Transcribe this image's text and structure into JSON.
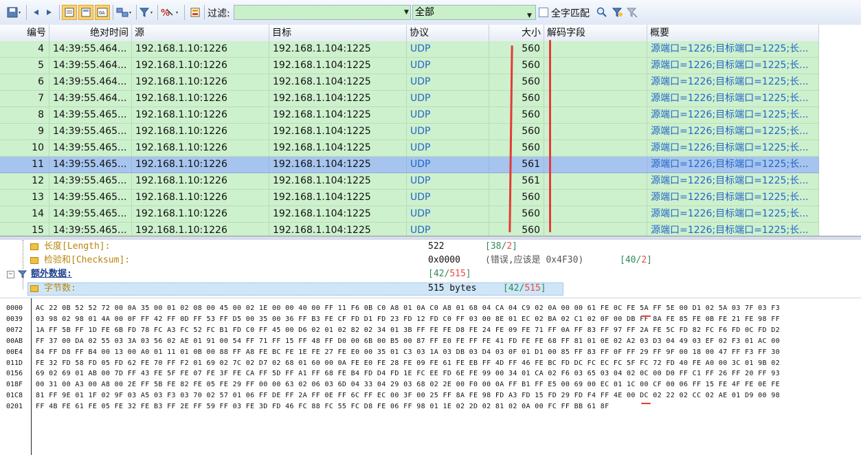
{
  "toolbar": {
    "filter_label": "过滤:",
    "filter_value": "",
    "scope_value": "全部",
    "full_match_label": "全字匹配",
    "icons": [
      "save-icon",
      "back-icon",
      "forward-icon",
      "view-list-icon",
      "view-detail-icon",
      "view-hex-icon",
      "network-icon",
      "filter-icon",
      "decode-icon",
      "clear-icon",
      "search-icon",
      "filter-apply-icon",
      "filter-clear-icon"
    ]
  },
  "grid": {
    "columns": [
      "编号",
      "绝对时间",
      "源",
      "目标",
      "协议",
      "大小",
      "解码字段",
      "概要"
    ],
    "rows": [
      {
        "id": "4",
        "time": "14:39:55.464...",
        "src": "192.168.1.10:1226",
        "dst": "192.168.1.104:1225",
        "proto": "UDP",
        "size": "560",
        "decode": "",
        "summary": "源端口=1226;目标端口=1225;长..."
      },
      {
        "id": "5",
        "time": "14:39:55.464...",
        "src": "192.168.1.10:1226",
        "dst": "192.168.1.104:1225",
        "proto": "UDP",
        "size": "560",
        "decode": "",
        "summary": "源端口=1226;目标端口=1225;长..."
      },
      {
        "id": "6",
        "time": "14:39:55.464...",
        "src": "192.168.1.10:1226",
        "dst": "192.168.1.104:1225",
        "proto": "UDP",
        "size": "560",
        "decode": "",
        "summary": "源端口=1226;目标端口=1225;长..."
      },
      {
        "id": "7",
        "time": "14:39:55.464...",
        "src": "192.168.1.10:1226",
        "dst": "192.168.1.104:1225",
        "proto": "UDP",
        "size": "560",
        "decode": "",
        "summary": "源端口=1226;目标端口=1225;长..."
      },
      {
        "id": "8",
        "time": "14:39:55.465...",
        "src": "192.168.1.10:1226",
        "dst": "192.168.1.104:1225",
        "proto": "UDP",
        "size": "560",
        "decode": "",
        "summary": "源端口=1226;目标端口=1225;长..."
      },
      {
        "id": "9",
        "time": "14:39:55.465...",
        "src": "192.168.1.10:1226",
        "dst": "192.168.1.104:1225",
        "proto": "UDP",
        "size": "560",
        "decode": "",
        "summary": "源端口=1226;目标端口=1225;长..."
      },
      {
        "id": "10",
        "time": "14:39:55.465...",
        "src": "192.168.1.10:1226",
        "dst": "192.168.1.104:1225",
        "proto": "UDP",
        "size": "560",
        "decode": "",
        "summary": "源端口=1226;目标端口=1225;长..."
      },
      {
        "id": "11",
        "time": "14:39:55.465...",
        "src": "192.168.1.10:1226",
        "dst": "192.168.1.104:1225",
        "proto": "UDP",
        "size": "561",
        "decode": "",
        "summary": "源端口=1226;目标端口=1225;长..."
      },
      {
        "id": "12",
        "time": "14:39:55.465...",
        "src": "192.168.1.10:1226",
        "dst": "192.168.1.104:1225",
        "proto": "UDP",
        "size": "561",
        "decode": "",
        "summary": "源端口=1226;目标端口=1225;长..."
      },
      {
        "id": "13",
        "time": "14:39:55.465...",
        "src": "192.168.1.10:1226",
        "dst": "192.168.1.104:1225",
        "proto": "UDP",
        "size": "560",
        "decode": "",
        "summary": "源端口=1226;目标端口=1225;长..."
      },
      {
        "id": "14",
        "time": "14:39:55.465...",
        "src": "192.168.1.10:1226",
        "dst": "192.168.1.104:1225",
        "proto": "UDP",
        "size": "560",
        "decode": "",
        "summary": "源端口=1226;目标端口=1225;长..."
      },
      {
        "id": "15",
        "time": "14:39:55.465...",
        "src": "192.168.1.10:1226",
        "dst": "192.168.1.104:1225",
        "proto": "UDP",
        "size": "560",
        "decode": "",
        "summary": "源端口=1226;目标端口=1225;长..."
      }
    ],
    "selected_id": "11"
  },
  "tree": {
    "length": {
      "label": "长度[Length]:",
      "value": "522",
      "pos_open": "[",
      "pos_off": "38",
      "pos_sep": "/",
      "pos_len": "2",
      "pos_close": "]"
    },
    "checksum": {
      "label": "检验和[Checksum]:",
      "value": "0x0000",
      "note": "(错误,应该是 0x4F30)",
      "pos_open": "[",
      "pos_off": "40",
      "pos_sep": "/",
      "pos_len": "2",
      "pos_close": "]"
    },
    "extra": {
      "label": "额外数据:",
      "pos_open": "[",
      "pos_off": "42",
      "pos_sep": "/",
      "pos_len": "515",
      "pos_close": "]"
    },
    "bytes": {
      "label": "字节数:",
      "value": "515 bytes",
      "pos_open": "[",
      "pos_off": "42",
      "pos_sep": "/",
      "pos_len": "515",
      "pos_close": "]"
    }
  },
  "hex": {
    "lines": [
      {
        "offset": "0000",
        "bytes": "AC 22 0B 52 52 72 00 0A 35 00 01 02 08 00 45 00 02 1E 00 00 40 00 FF 11 F6 0B C0 A8 01 0A C0 A8 01 68 04 CA 04 C9 02 0A 00 00 61 FE 0C FE 5A FF 5E 00 D1 02 5A 03 7F 03 F3"
      },
      {
        "offset": "0039",
        "bytes": "03 98 02 98 01 4A 00 0F FF 42 FF 0D FF 53 FF D5 00 35 00 36 FF B3 FE CF FD D1 FD 23 FD 12 FD C0 FF 03 00 8E 01 EC 02 BA 02 C1 02 0F 00 DB FF 8A FE 85 FE 0B FE 21 FE 98 FF"
      },
      {
        "offset": "0072",
        "bytes": "1A FF 5B FF 1D FE 6B FD 78 FC A3 FC 52 FC B1 FD C0 FF 45 00 D6 02 01 02 82 02 34 01 3B FF FE FE D8 FE 24 FE 09 FE 71 FF 0A FF 83 FF 97 FF 2A FE 5C FD 82 FC F6 FD 0C FD D2"
      },
      {
        "offset": "00AB",
        "bytes": "FF 37 00 DA 02 55 03 3A 03 56 02 AE 01 91 00 54 FF 71 FF 15 FF 48 FF D0 00 6B 00 B5 00 87 FF E0 FE FF FE 41 FD FE FE 68 FF 81 01 0E 02 A2 03 D3 04 49 03 EF 02 F3 01 AC 00"
      },
      {
        "offset": "00E4",
        "bytes": "84 FF D8 FF B4 00 13 00 A0 01 11 01 0B 00 88 FF A8 FE BC FE 1E FE 27 FE E0 00 35 01 C3 03 1A 03 DB 03 D4 03 0F 01 D1 00 85 FF 83 FF 0F FF 29 FF 9F 00 18 00 47 FF F3 FF 30"
      },
      {
        "offset": "011D",
        "bytes": "FE 32 FD 58 FD 05 FD 62 FE 70 FF F2 01 69 02 7C 02 D7 02 68 01 60 00 0A FE E0 FE 28 FE 09 FE 61 FE EB FF 4D FF 46 FE BC FD DC FC EC FC 5F FC 72 FD 40 FE A0 00 3C 01 9B 02"
      },
      {
        "offset": "0156",
        "bytes": "69 02 69 01 AB 00 7D FF 43 FE 5F FE 07 FE 3F FE CA FF 5D FF A1 FF 68 FE B4 FD D4 FD 1E FC EE FD 6E FE 99 00 34 01 CA 02 F6 03 65 03 04 02 0C 00 D0 FF C1 FF 26 FF 20 FF 93"
      },
      {
        "offset": "018F",
        "bytes": "00 31 00 A3 00 A8 00 2E FF 5B FE 82 FE 05 FE 29 FF 00 00 63 02 06 03 6D 04 33 04 29 03 68 02 2E 00 F0 00 0A FF B1 FF E5 00 69 00 EC 01 1C 00 CF 00 06 FF 15 FE 4F FE 0E FE"
      },
      {
        "offset": "01C8",
        "bytes": "81 FF 9E 01 1F 02 9F 03 A5 03 F3 03 70 02 57 01 06 FF DE FF 2A FF 0E FF 6C FF EC 00 3F 00 25 FF 8A FE 98 FD A3 FD 15 FD 29 FD F4 FF 4E 00 DC 02 22 02 CC 02 AE 01 D9 00 98"
      },
      {
        "offset": "0201",
        "bytes": "FF 4B FE 61 FE 05 FE 32 FE B3 FF 2E FF 59 FF 03 FE 3D FD 46 FC 88 FC 55 FC D8 FE 06 FF 98 01 1E 02 2D 02 81 02 0A 00 FC FF BB 61 8F"
      }
    ]
  }
}
